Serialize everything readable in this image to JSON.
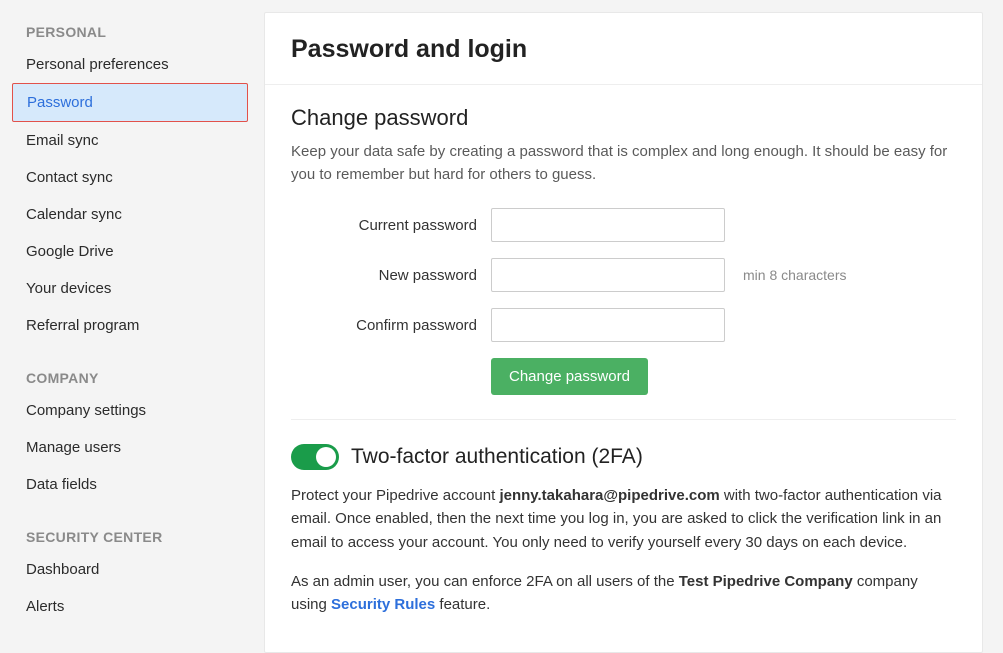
{
  "sidebar": {
    "sections": [
      {
        "header": "PERSONAL",
        "items": [
          {
            "label": "Personal preferences"
          },
          {
            "label": "Password",
            "active": true
          },
          {
            "label": "Email sync"
          },
          {
            "label": "Contact sync"
          },
          {
            "label": "Calendar sync"
          },
          {
            "label": "Google Drive"
          },
          {
            "label": "Your devices"
          },
          {
            "label": "Referral program"
          }
        ]
      },
      {
        "header": "COMPANY",
        "items": [
          {
            "label": "Company settings"
          },
          {
            "label": "Manage users"
          },
          {
            "label": "Data fields"
          }
        ]
      },
      {
        "header": "SECURITY CENTER",
        "items": [
          {
            "label": "Dashboard"
          },
          {
            "label": "Alerts"
          }
        ]
      }
    ]
  },
  "page": {
    "title": "Password and login"
  },
  "change_password": {
    "title": "Change password",
    "description": "Keep your data safe by creating a password that is complex and long enough. It should be easy for you to remember but hard for others to guess.",
    "current_label": "Current password",
    "new_label": "New password",
    "new_hint": "min 8 characters",
    "confirm_label": "Confirm password",
    "submit_label": "Change password"
  },
  "twofa": {
    "enabled": true,
    "title": "Two-factor authentication (2FA)",
    "desc_prefix": "Protect your Pipedrive account ",
    "account_email": "jenny.takahara@pipedrive.com",
    "desc_suffix": " with two-factor authentication via email. Once enabled, then the next time you log in, you are asked to click the verification link in an email to access your account. You only need to verify yourself every 30 days on each device.",
    "admin_prefix": "As an admin user, you can enforce 2FA on all users of the ",
    "company_name": "Test Pipedrive Company",
    "admin_mid": " company using ",
    "link_label": "Security Rules",
    "admin_suffix": " feature."
  }
}
